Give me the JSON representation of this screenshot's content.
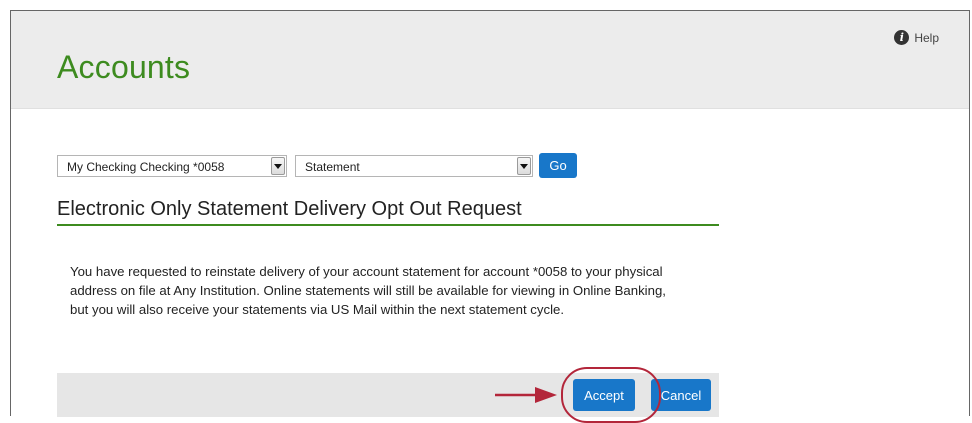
{
  "header": {
    "title": "Accounts",
    "help_label": "Help",
    "help_icon": "info-circle-icon",
    "title_color": "#3d8b1f",
    "background": "#ececec"
  },
  "filters": {
    "account_select": {
      "value": "My Checking Checking *0058"
    },
    "document_select": {
      "value": "Statement"
    },
    "go_label": "Go"
  },
  "section": {
    "title": "Electronic Only Statement Delivery Opt Out Request",
    "rule_color": "#3d8b1f"
  },
  "message": "You have requested to reinstate delivery of your account statement for account *0058 to your physical address on file at Any Institution. Online statements will still be available for viewing in Online Banking, but you will also receive your statements via US Mail within the next statement cycle.",
  "actions": {
    "accept_label": "Accept",
    "cancel_label": "Cancel",
    "button_color": "#1877c9"
  },
  "annotation": {
    "highlight_color": "#b3263a",
    "arrow_icon": "right-arrow-icon"
  }
}
